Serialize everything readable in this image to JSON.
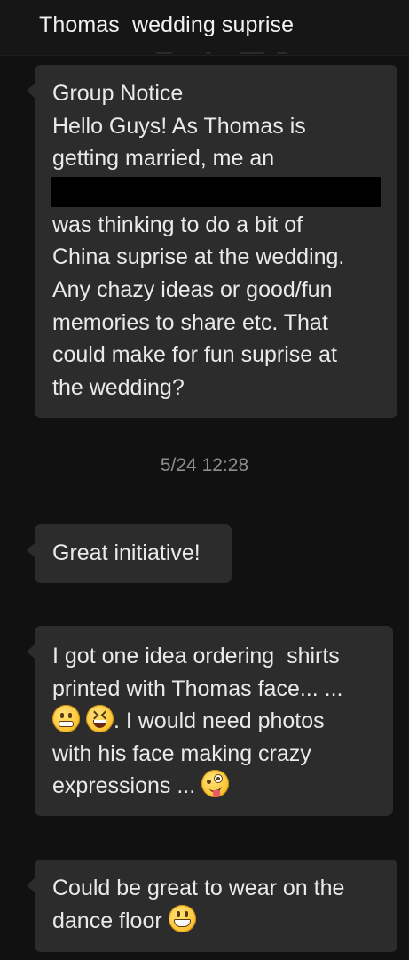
{
  "header": {
    "title": "Thomas  wedding suprise"
  },
  "messages": [
    {
      "lines": [
        "Group Notice",
        "Hello Guys! As Thomas is",
        "getting married, me an",
        "was thinking to do a bit of",
        "China suprise at the wedding.",
        "Any chazy ideas or good/fun",
        "memories to share etc. That",
        "could make for fun suprise at",
        "the wedding?"
      ]
    },
    {
      "lines": [
        "Great initiative!"
      ]
    },
    {
      "lines": [
        "I got one idea ordering  shirts",
        "printed with Thomas face... ...",
        ". I would need photos",
        "with his face making crazy",
        "expressions ..."
      ],
      "emojis": [
        "grimacing-face-icon",
        "laughing-squinting-face-icon",
        "zany-face-icon"
      ]
    },
    {
      "lines": [
        "Could be great to wear on the",
        "dance floor"
      ],
      "emojis": [
        "grinning-face-icon"
      ]
    }
  ],
  "timestamp": "5/24 12:28",
  "colors": {
    "background": "#111111",
    "header": "#161616",
    "bubble": "#2c2c2c",
    "text": "#eaeaea",
    "timestamp": "#8d8d8d",
    "redaction": "#000000"
  }
}
